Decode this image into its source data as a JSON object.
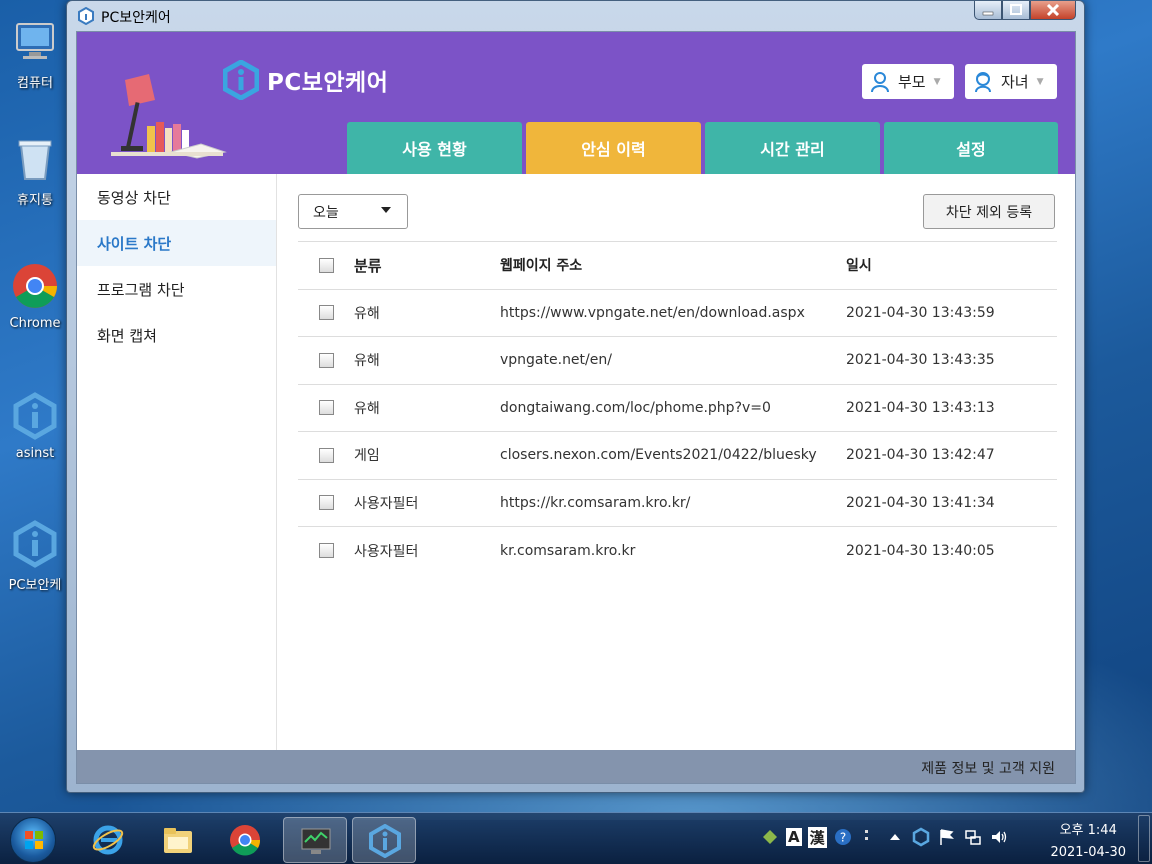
{
  "desktop": {
    "icons": [
      {
        "label": "컴퓨터",
        "icon": "computer-icon"
      },
      {
        "label": "휴지통",
        "icon": "recycle-bin-icon"
      },
      {
        "label": "Chrome",
        "icon": "chrome-icon"
      },
      {
        "label": "asinst",
        "icon": "asinst-icon"
      },
      {
        "label": "PC보안케",
        "icon": "pc-security-care-icon"
      }
    ]
  },
  "window": {
    "title": "PC보안케어",
    "controls": [
      "minimize",
      "maximize",
      "close"
    ]
  },
  "header": {
    "brand": "PC보안케어",
    "roles": [
      {
        "label": "부모"
      },
      {
        "label": "자녀"
      }
    ],
    "tabs": [
      {
        "label": "사용 현황",
        "active": false
      },
      {
        "label": "안심 이력",
        "active": true
      },
      {
        "label": "시간 관리",
        "active": false
      },
      {
        "label": "설정",
        "active": false
      }
    ]
  },
  "sidebar": {
    "items": [
      {
        "label": "동영상 차단",
        "active": false
      },
      {
        "label": "사이트 차단",
        "active": true
      },
      {
        "label": "프로그램 차단",
        "active": false
      },
      {
        "label": "화면 캡쳐",
        "active": false
      }
    ]
  },
  "main": {
    "period_select": "오늘",
    "exclude_button": "차단 제외 등록",
    "columns": [
      "분류",
      "웹페이지 주소",
      "일시"
    ],
    "rows": [
      {
        "category": "유해",
        "url": "https://www.vpngate.net/en/download.aspx",
        "datetime": "2021-04-30 13:43:59"
      },
      {
        "category": "유해",
        "url": "vpngate.net/en/",
        "datetime": "2021-04-30 13:43:35"
      },
      {
        "category": "유해",
        "url": "dongtaiwang.com/loc/phome.php?v=0",
        "datetime": "2021-04-30 13:43:13"
      },
      {
        "category": "게임",
        "url": "closers.nexon.com/Events2021/0422/bluesky",
        "datetime": "2021-04-30 13:42:47"
      },
      {
        "category": "사용자필터",
        "url": "https://kr.comsaram.kro.kr/",
        "datetime": "2021-04-30 13:41:34"
      },
      {
        "category": "사용자필터",
        "url": "kr.comsaram.kro.kr",
        "datetime": "2021-04-30 13:40:05"
      }
    ]
  },
  "footer": {
    "link": "제품 정보 및 고객 지원"
  },
  "taskbar": {
    "clock_time": "오후 1:44",
    "clock_date": "2021-04-30",
    "ime_label": "A",
    "hanja_label": "漢"
  },
  "colors": {
    "header_purple": "#7c53c7",
    "tab_teal": "#3fb5a8",
    "tab_active": "#f0b63b",
    "sidebar_active_text": "#2a78c8"
  }
}
